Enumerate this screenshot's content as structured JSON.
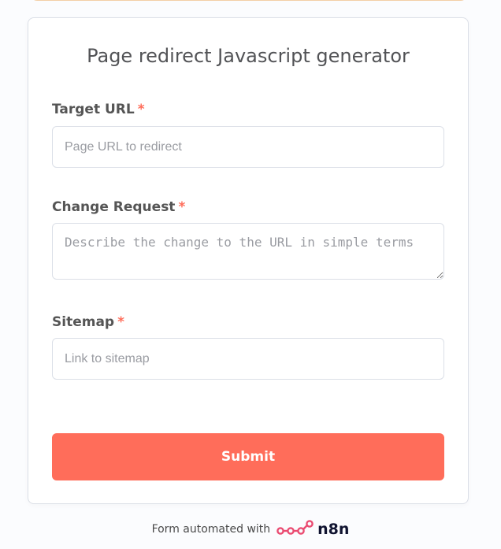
{
  "form": {
    "title": "Page redirect Javascript generator",
    "required_marker": "*",
    "fields": [
      {
        "label": "Target URL",
        "placeholder": "Page URL to redirect"
      },
      {
        "label": "Change Request",
        "placeholder": "Describe the change to the URL in simple terms"
      },
      {
        "label": "Sitemap",
        "placeholder": "Link to sitemap"
      }
    ],
    "submit_label": "Submit"
  },
  "footer": {
    "text": "Form automated with",
    "brand": "n8n",
    "logo_icon": "n8n-logo-icon"
  },
  "colors": {
    "accent": "#ff6d5a",
    "label": "#555555",
    "border": "#dbdfe7",
    "brand_pink": "#ea4b71"
  }
}
